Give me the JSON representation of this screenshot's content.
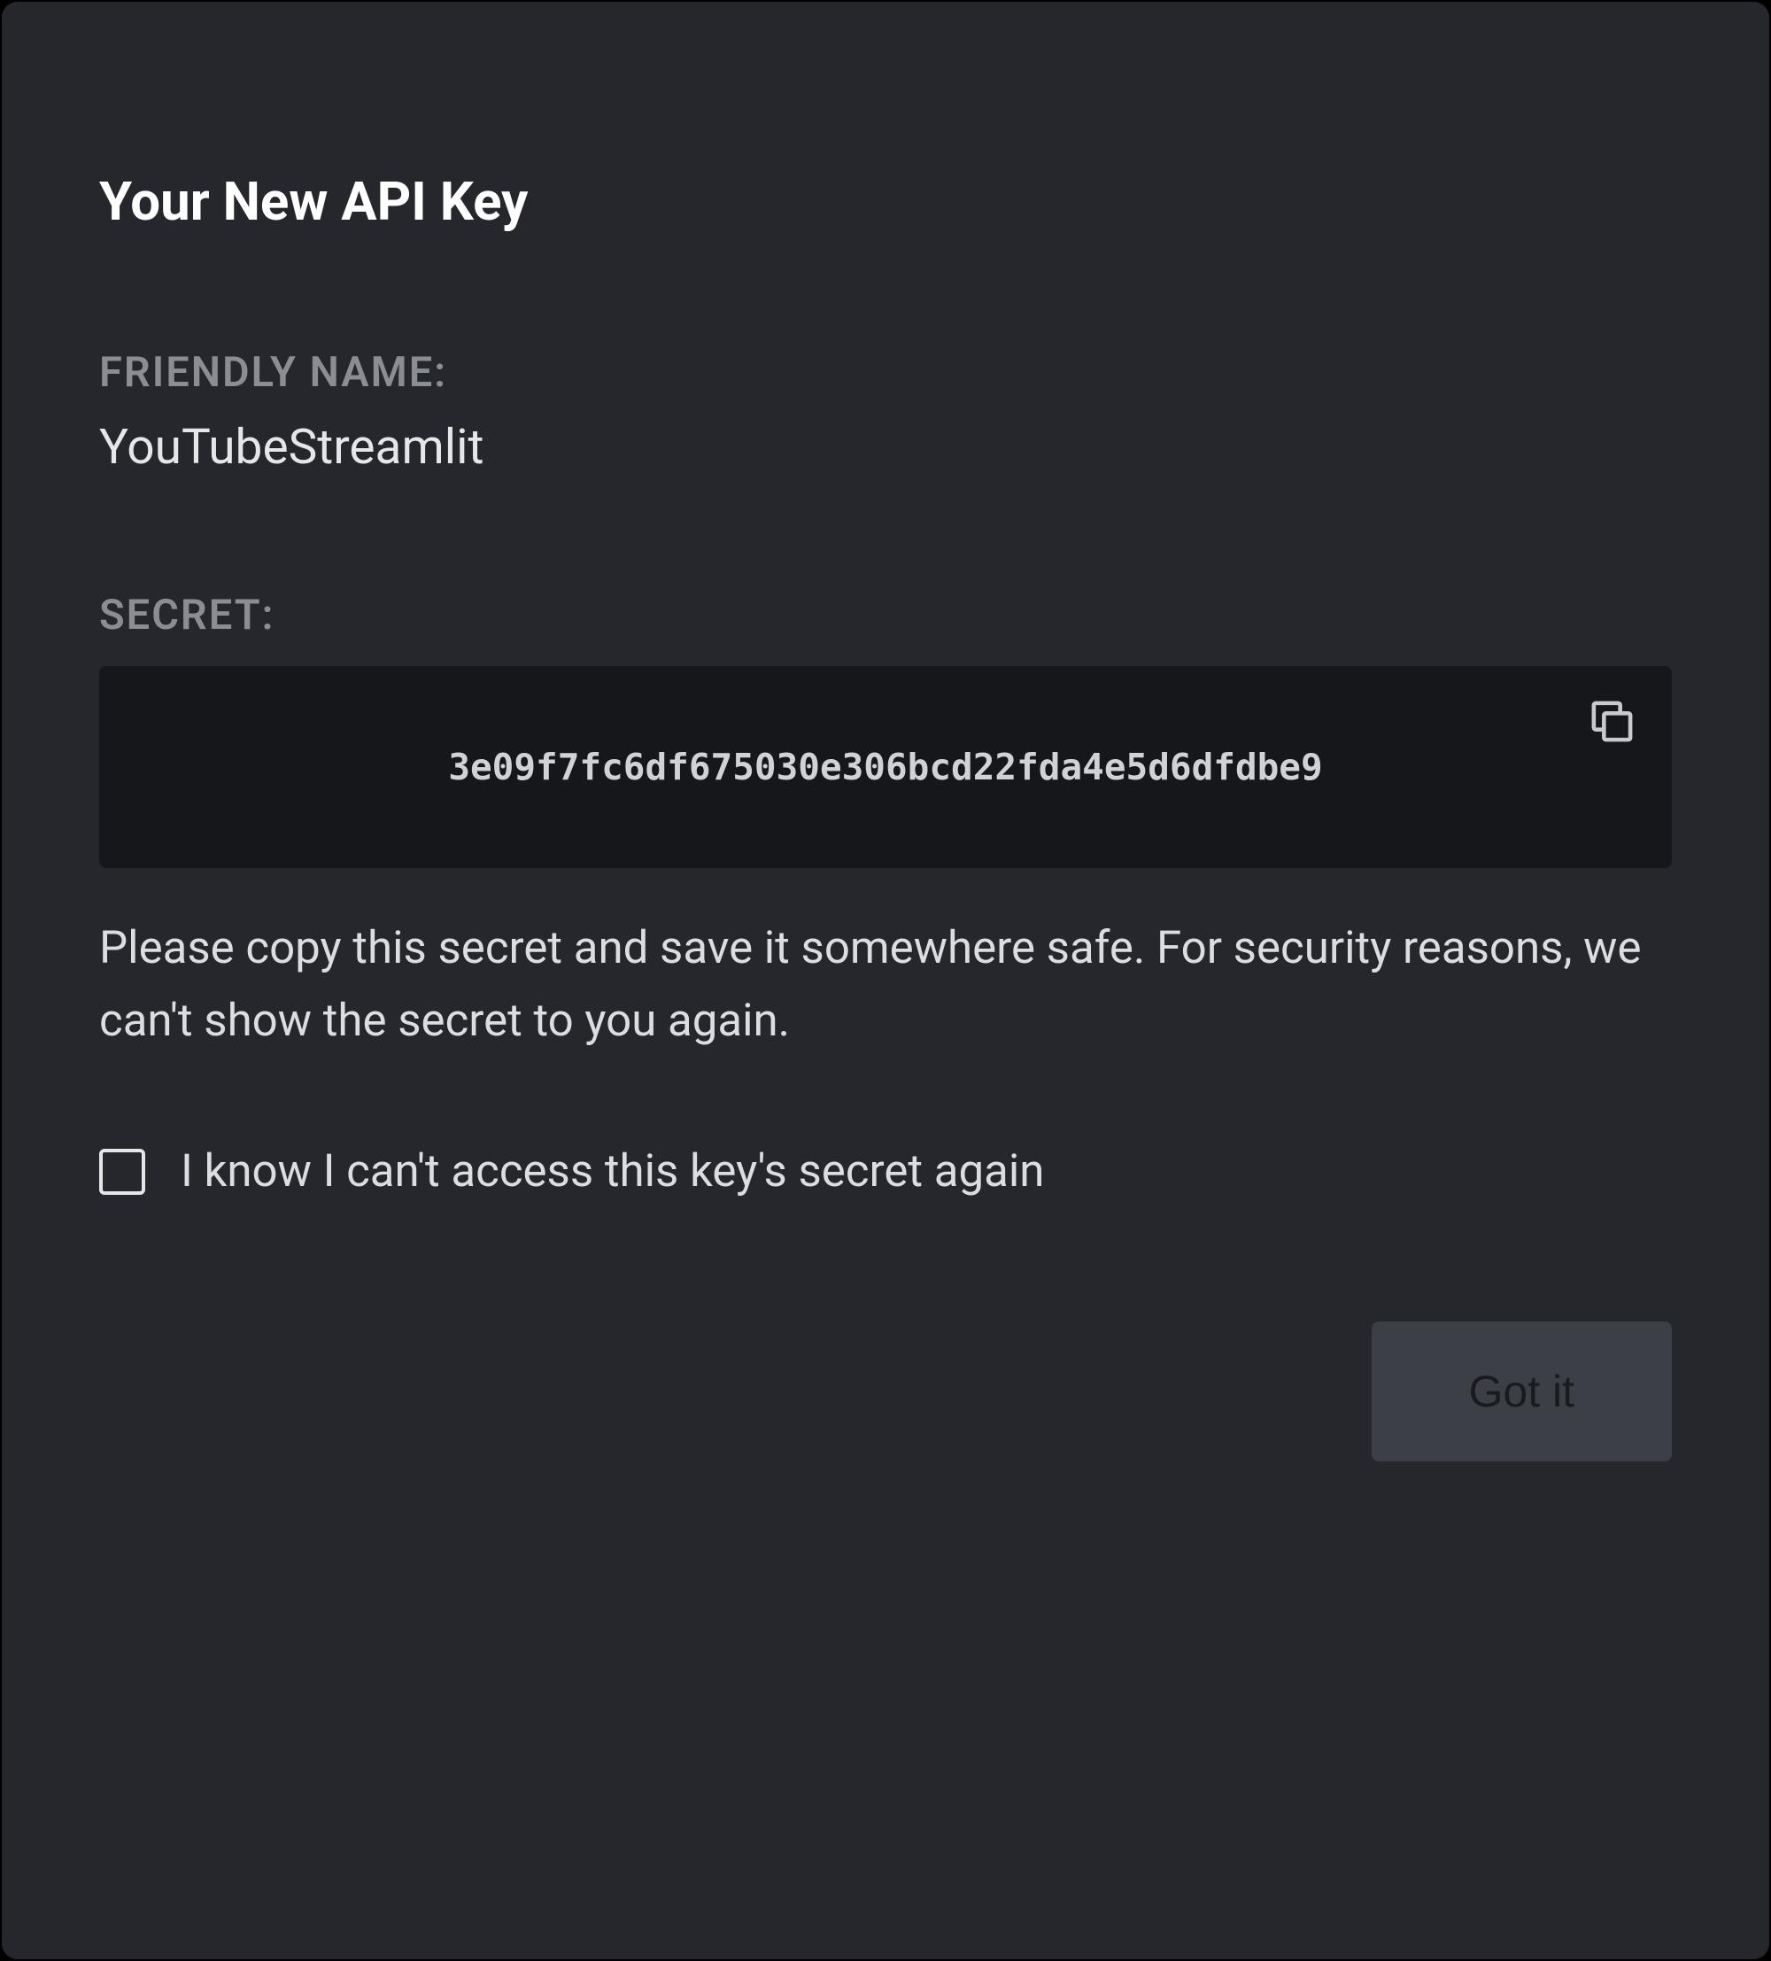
{
  "modal": {
    "title": "Your New API Key",
    "friendly_name_label": "FRIENDLY NAME:",
    "friendly_name_value": "YouTubeStreamlit",
    "secret_label": "SECRET:",
    "secret_value": "3e09f7fc6df675030e306bcd22fda4e5d6dfdbe9",
    "warning_text": "Please copy this secret and save it somewhere safe. For security reasons, we can't show the secret to you again.",
    "checkbox_label": "I know I can't access this key's secret again",
    "confirm_button_label": "Got it"
  }
}
